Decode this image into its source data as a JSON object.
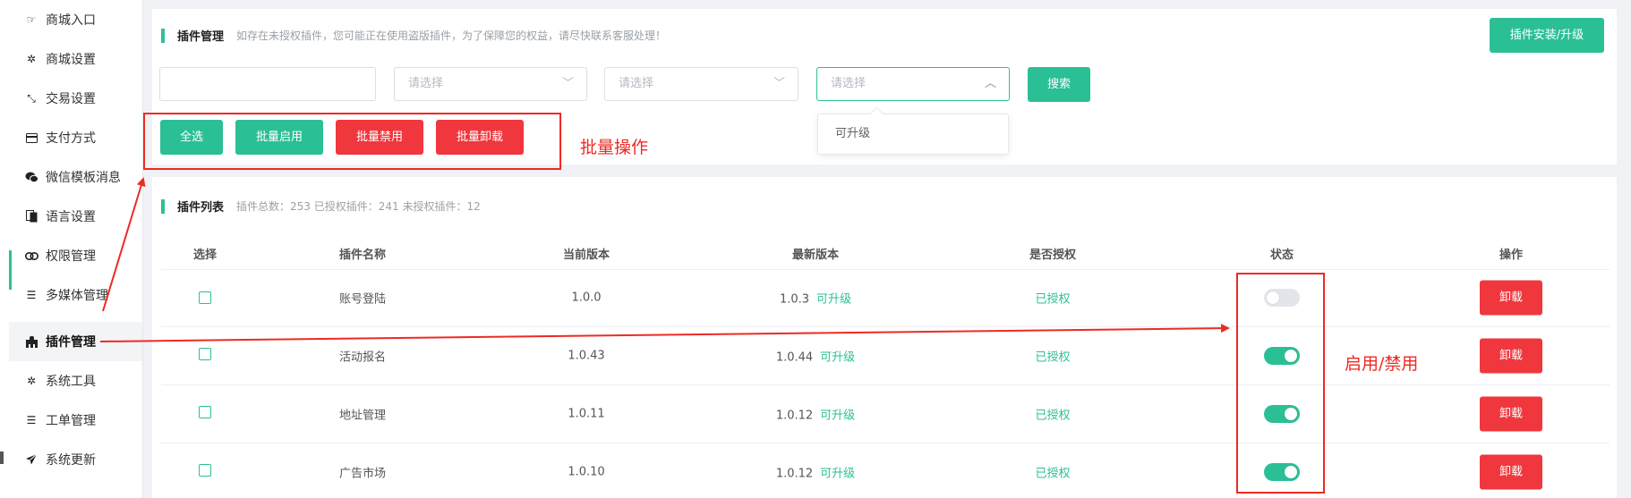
{
  "sidebar": {
    "items": [
      {
        "label": "商城入口",
        "icon": "hand-point-icon"
      },
      {
        "label": "商城设置",
        "icon": "gear-icon"
      },
      {
        "label": "交易设置",
        "icon": "arrows-icon"
      },
      {
        "label": "支付方式",
        "icon": "credit-card-icon"
      },
      {
        "label": "微信模板消息",
        "icon": "wechat-icon"
      },
      {
        "label": "语言设置",
        "icon": "language-icon"
      },
      {
        "label": "权限管理",
        "icon": "link-icon"
      },
      {
        "label": "多媒体管理",
        "icon": "list-icon"
      },
      {
        "label": "插件管理",
        "icon": "puzzle-icon"
      },
      {
        "label": "系统工具",
        "icon": "gear-icon"
      },
      {
        "label": "工单管理",
        "icon": "list-icon"
      },
      {
        "label": "系统更新",
        "icon": "paper-plane-icon"
      }
    ],
    "active_label": "插件管理"
  },
  "header": {
    "title": "插件管理",
    "note": "如存在未授权插件，您可能正在使用盗版插件，为了保障您的权益，请尽快联系客服处理！",
    "install_button": "插件安装/升级"
  },
  "filters": {
    "text_input_value": "",
    "select1_placeholder": "请选择",
    "select2_placeholder": "请选择",
    "select3_placeholder": "请选择",
    "search_button": "搜索",
    "dropdown_option": "可升级"
  },
  "batch": {
    "select_all": "全选",
    "enable": "批量启用",
    "disable": "批量禁用",
    "uninstall": "批量卸载"
  },
  "list": {
    "title": "插件列表",
    "stats": "插件总数：253 已授权插件：241 未授权插件：12",
    "columns": [
      "选择",
      "插件名称",
      "当前版本",
      "最新版本",
      "是否授权",
      "状态",
      "操作"
    ],
    "upgrade_text": "可升级",
    "rows": [
      {
        "name": "账号登陆",
        "current": "1.0.0",
        "latest": "1.0.3",
        "auth": "已授权",
        "enabled": false,
        "action": "卸载"
      },
      {
        "name": "活动报名",
        "current": "1.0.43",
        "latest": "1.0.44",
        "auth": "已授权",
        "enabled": true,
        "action": "卸载"
      },
      {
        "name": "地址管理",
        "current": "1.0.11",
        "latest": "1.0.12",
        "auth": "已授权",
        "enabled": true,
        "action": "卸载"
      },
      {
        "name": "广告市场",
        "current": "1.0.10",
        "latest": "1.0.12",
        "auth": "已授权",
        "enabled": true,
        "action": "卸载"
      }
    ]
  },
  "annotations": {
    "batch_label": "批量操作",
    "toggle_label": "启用/禁用",
    "color": "#ee2a24"
  },
  "colors": {
    "accent": "#2bbf96",
    "danger": "#f0373d"
  }
}
